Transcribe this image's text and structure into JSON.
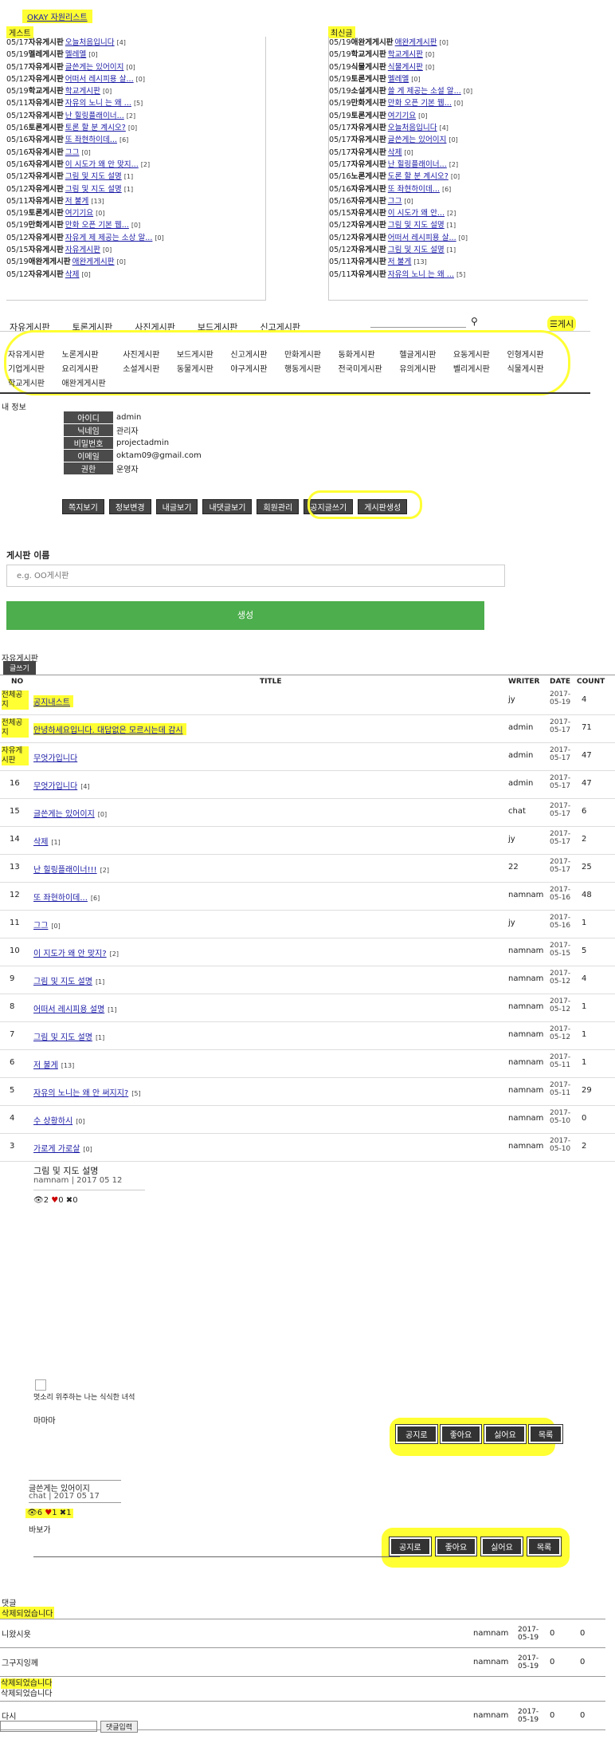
{
  "top_link": "OKAY 자원리스트",
  "recent_left": {
    "label": "게스트",
    "rows": [
      {
        "d": "05/17",
        "b": "자유게시판",
        "t": "오늘처음입니다",
        "c": "[4]"
      },
      {
        "d": "05/19",
        "b": "멜레게시판",
        "t": "멜레멜",
        "c": "[0]"
      },
      {
        "d": "05/17",
        "b": "자유게시판",
        "t": "글쓴게는 있어이지",
        "c": "[0]"
      },
      {
        "d": "05/12",
        "b": "자유게시판",
        "t": "어떠서 레시피용 살...",
        "c": "[0]"
      },
      {
        "d": "05/19",
        "b": "학교게시판",
        "t": "학교게시판",
        "c": "[0]"
      },
      {
        "d": "05/11",
        "b": "자유게시판",
        "t": "자유의 노니 는 왜 ...",
        "c": "[5]"
      },
      {
        "d": "05/12",
        "b": "자유게시판",
        "t": "난 힐링플래이너...",
        "c": "[2]"
      },
      {
        "d": "05/16",
        "b": "토론게시판",
        "t": "토론 할 분 계시오?",
        "c": "[0]"
      },
      {
        "d": "05/16",
        "b": "자유게시판",
        "t": "또 좌현하이데...",
        "c": "[6]"
      },
      {
        "d": "05/16",
        "b": "자유게시판",
        "t": "그그",
        "c": "[0]"
      },
      {
        "d": "05/16",
        "b": "자유게시판",
        "t": "이 시도가 왜 안 맞지...",
        "c": "[2]"
      },
      {
        "d": "05/12",
        "b": "자유게시판",
        "t": "그림 및 지도 설명",
        "c": "[1]"
      },
      {
        "d": "05/12",
        "b": "자유게시판",
        "t": "그림 및 지도 설명",
        "c": "[1]"
      },
      {
        "d": "05/11",
        "b": "자유게시판",
        "t": "저 불게",
        "c": "[13]"
      },
      {
        "d": "05/19",
        "b": "토론게시판",
        "t": "여기기요",
        "c": "[0]"
      },
      {
        "d": "05/19",
        "b": "만화게시판",
        "t": "만화 오픈 기본 웹...",
        "c": "[0]"
      },
      {
        "d": "05/12",
        "b": "자유게시판",
        "t": "자유게 제 제공는 소상 알...",
        "c": "[0]"
      },
      {
        "d": "05/15",
        "b": "자유게시판",
        "t": "자유게시판",
        "c": "[0]"
      },
      {
        "d": "05/19",
        "b": "애완게게시판",
        "t": "애완게게시판",
        "c": "[0]"
      },
      {
        "d": "05/12",
        "b": "자유게시판",
        "t": "삭제",
        "c": "[0]"
      }
    ]
  },
  "recent_right": {
    "label": "최신글",
    "rows": [
      {
        "d": "05/19",
        "b": "애완게게시판",
        "t": "애완게게시판",
        "c": "[0]"
      },
      {
        "d": "05/19",
        "b": "학교게시판",
        "t": "학교게시판",
        "c": "[0]"
      },
      {
        "d": "05/19",
        "b": "식물게시판",
        "t": "식물게시판",
        "c": "[0]"
      },
      {
        "d": "05/19",
        "b": "토론게시판",
        "t": "멜레멜",
        "c": "[0]"
      },
      {
        "d": "05/19",
        "b": "소설게시판",
        "t": "쓸 게 제공는 소설 알...",
        "c": "[0]"
      },
      {
        "d": "05/19",
        "b": "만화게시판",
        "t": "만화 오픈 기본 웹...",
        "c": "[0]"
      },
      {
        "d": "05/19",
        "b": "토론게시판",
        "t": "여기기요",
        "c": "[0]"
      },
      {
        "d": "05/17",
        "b": "자유게시판",
        "t": "오늘처음입니다",
        "c": "[4]"
      },
      {
        "d": "05/17",
        "b": "자유게시판",
        "t": "글쓴게는 있어이지",
        "c": "[0]"
      },
      {
        "d": "05/17",
        "b": "자유게시판",
        "t": "삭제",
        "c": "[0]"
      },
      {
        "d": "05/17",
        "b": "자유게시판",
        "t": "난 힐링플래이너...",
        "c": "[2]"
      },
      {
        "d": "05/16",
        "b": "노론게시판",
        "t": "도론 할 분 계시오?",
        "c": "[0]"
      },
      {
        "d": "05/16",
        "b": "자유게시판",
        "t": "또 좌현하이데...",
        "c": "[6]"
      },
      {
        "d": "05/16",
        "b": "자유게시판",
        "t": "그그",
        "c": "[0]"
      },
      {
        "d": "05/15",
        "b": "자유게시판",
        "t": "이 시도가 왜 안...",
        "c": "[2]"
      },
      {
        "d": "05/12",
        "b": "자유게시판",
        "t": "그림 및 지도 설명",
        "c": "[1]"
      },
      {
        "d": "05/12",
        "b": "자유게시판",
        "t": "어떠서 레시피용 살...",
        "c": "[0]"
      },
      {
        "d": "05/12",
        "b": "자유게시판",
        "t": "그림 및 지도 설명",
        "c": "[1]"
      },
      {
        "d": "05/11",
        "b": "자유게시판",
        "t": "저 불게",
        "c": "[13]"
      },
      {
        "d": "05/11",
        "b": "자유게시판",
        "t": "자유의 노니 는 왜 ...",
        "c": "[5]"
      }
    ]
  },
  "nav": [
    "자유게시판",
    "토론게시판",
    "사진게시판",
    "보드게시판",
    "신고게시판"
  ],
  "menu_label": "게시",
  "boards": [
    "자유게시판",
    "노론게시판",
    "사진게시판",
    "보드게시판",
    "신고게시판",
    "만화게시판",
    "동화게시판",
    "헬글게시판",
    "요동게시판",
    "인형게시판",
    "기업게시판",
    "요리게시판",
    "소설게시판",
    "동물게시판",
    "야구게시판",
    "행동게시판",
    "전국미게시판",
    "유의게시판",
    "벨리게시판",
    "식물게시판",
    "학교게시판",
    "애완게게시판"
  ],
  "myinfo": {
    "title": "내 정보",
    "rows": [
      {
        "k": "아이디",
        "v": "admin"
      },
      {
        "k": "닉네임",
        "v": "관리자"
      },
      {
        "k": "비밀번호",
        "v": "projectadmin"
      },
      {
        "k": "이메일",
        "v": "oktam09@gmail.com"
      },
      {
        "k": "권한",
        "v": "운영자"
      }
    ],
    "buttons": [
      "쪽지보기",
      "정보변경",
      "내글보기",
      "내댓글보기",
      "회원관리",
      "공지글쓰기",
      "게시판생성"
    ]
  },
  "create_board": {
    "title": "게시판 이름",
    "placeholder": "e.g. OO게시판",
    "submit": "생성"
  },
  "board": {
    "name": "자유게시판",
    "write_btn": "글쓰기",
    "headers": {
      "no": "NO",
      "title": "TITLE",
      "writer": "WRITER",
      "date": "DATE",
      "count": "COUNT"
    },
    "posts": [
      {
        "no": "전체공지",
        "title": "공지내스트",
        "c": "",
        "writer": "jy",
        "date": "2017-05-19",
        "count": "4"
      },
      {
        "no": "전체공지",
        "title": "안녕하세요입니다. 대답없은 모르시는데 감시",
        "c": "",
        "writer": "admin",
        "date": "2017-05-17",
        "count": "71"
      },
      {
        "no": "자유게시판",
        "title": "무엇가입니다",
        "c": "",
        "writer": "admin",
        "date": "2017-05-17",
        "count": "47"
      },
      {
        "no": "16",
        "title": "무엇가입니다",
        "c": "[4]",
        "writer": "admin",
        "date": "2017-05-17",
        "count": "47"
      },
      {
        "no": "15",
        "title": "글쓴게는 있어이지",
        "c": "[0]",
        "writer": "chat",
        "date": "2017-05-17",
        "count": "6"
      },
      {
        "no": "14",
        "title": "삭제",
        "c": "[1]",
        "writer": "jy",
        "date": "2017-05-17",
        "count": "2"
      },
      {
        "no": "13",
        "title": "난 힐링플래이너!!!",
        "c": "[2]",
        "writer": "22",
        "date": "2017-05-17",
        "count": "25"
      },
      {
        "no": "12",
        "title": "또 좌현하이데...",
        "c": "[6]",
        "writer": "namnam",
        "date": "2017-05-16",
        "count": "48"
      },
      {
        "no": "11",
        "title": "그그",
        "c": "[0]",
        "writer": "jy",
        "date": "2017-05-16",
        "count": "1"
      },
      {
        "no": "10",
        "title": "이 지도가 왜 안 맞지?",
        "c": "[2]",
        "writer": "namnam",
        "date": "2017-05-15",
        "count": "5"
      },
      {
        "no": "9",
        "title": "그림 및 지도 설명",
        "c": "[1]",
        "writer": "namnam",
        "date": "2017-05-12",
        "count": "4"
      },
      {
        "no": "8",
        "title": "어떠서 레시피용 설명",
        "c": "[1]",
        "writer": "namnam",
        "date": "2017-05-12",
        "count": "1"
      },
      {
        "no": "7",
        "title": "그림 및 지도 설명",
        "c": "[1]",
        "writer": "namnam",
        "date": "2017-05-12",
        "count": "1"
      },
      {
        "no": "6",
        "title": "저 불게",
        "c": "[13]",
        "writer": "namnam",
        "date": "2017-05-11",
        "count": "1"
      },
      {
        "no": "5",
        "title": "자유의 노니는 왜 안 써지지?",
        "c": "[5]",
        "writer": "namnam",
        "date": "2017-05-11",
        "count": "29"
      },
      {
        "no": "4",
        "title": "수 상황하시",
        "c": "[0]",
        "writer": "namnam",
        "date": "2017-05-10",
        "count": "0"
      },
      {
        "no": "3",
        "title": "가로게 가로살",
        "c": "[0]",
        "writer": "namnam",
        "date": "2017-05-10",
        "count": "2"
      }
    ]
  },
  "post1": {
    "title": "그림 및 지도 설명",
    "meta": "namnam | 2017 05 12",
    "views": "2",
    "likes": "0",
    "dislikes": "0",
    "img_caption": "멋소리 위주하는 나는 식식한 녀석",
    "body": "마마마",
    "buttons": [
      "공지로",
      "좋아요",
      "싫어요",
      "목록"
    ]
  },
  "post2": {
    "title": "글쓴게는 있어이지",
    "meta": "chat | 2017 05 17",
    "views": "6",
    "likes": "1",
    "dislikes": "1",
    "body": "바보가",
    "buttons": [
      "공지로",
      "좋아요",
      "싫어요",
      "목록"
    ]
  },
  "comments": {
    "title": "댓글",
    "deleted": "삭제되었습니다",
    "rows": [
      {
        "text": "니왔시욧",
        "writer": "namnam",
        "date": "2017-05-19",
        "a": "0",
        "b": "0"
      },
      {
        "text": "그구지잉께",
        "writer": "namnam",
        "date": "2017-05-19",
        "a": "0",
        "b": "0"
      },
      {
        "text": "다시",
        "writer": "namnam",
        "date": "2017-05-19",
        "a": "0",
        "b": "0"
      }
    ],
    "submit": "댓글입력"
  }
}
